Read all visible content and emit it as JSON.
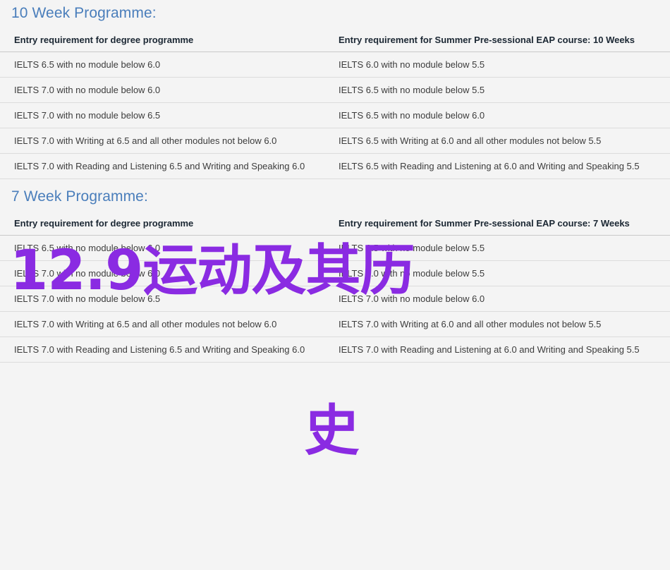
{
  "colors": {
    "background": "#f4f4f4",
    "heading": "#4a7ebb",
    "header_text": "#1b2733",
    "cell_text": "#3c3c3c",
    "row_border": "#dcdcdc",
    "header_border": "#c9c9c9",
    "watermark": "#8A2BE2"
  },
  "watermark": {
    "line1": "12.9运动及其历",
    "line2": "史",
    "full_text": "12.9运动及其历史"
  },
  "sections": [
    {
      "heading": "10 Week Programme:",
      "left_table": {
        "header": "Entry requirement for degree programme",
        "rows": [
          "IELTS 6.5 with no module below 6.0",
          "IELTS 7.0 with no module below 6.0",
          "IELTS 7.0 with no module below 6.5",
          "IELTS 7.0 with Writing at 6.5 and all other modules not below 6.0",
          "IELTS 7.0 with Reading and Listening 6.5 and Writing and Speaking 6.0"
        ]
      },
      "right_table": {
        "header": "Entry requirement for Summer Pre-sessional EAP course: 10 Weeks",
        "rows": [
          "IELTS 6.0 with no module below 5.5",
          "IELTS 6.5 with no module below 5.5",
          "IELTS 6.5 with no module below 6.0",
          "IELTS 6.5 with Writing at 6.0 and all other modules not below 5.5",
          "IELTS 6.5 with Reading and Listening at 6.0 and Writing and Speaking 5.5"
        ]
      }
    },
    {
      "heading": "7 Week Programme:",
      "left_table": {
        "header": "Entry requirement for degree programme",
        "rows": [
          "IELTS 6.5 with no module below 6.0",
          "IELTS 7.0 with no module below 6.0",
          "IELTS 7.0 with no module below 6.5",
          "IELTS 7.0 with Writing at 6.5 and all other modules not below 6.0",
          "IELTS 7.0 with Reading and Listening 6.5 and Writing and Speaking 6.0"
        ]
      },
      "right_table": {
        "header": "Entry requirement for Summer Pre-sessional EAP course: 7 Weeks",
        "rows": [
          "IELTS 6.5 with no module below 5.5",
          "IELTS 7.0 with no module below 5.5",
          "IELTS 7.0 with no module below 6.0",
          "IELTS 7.0 with Writing at 6.0 and all other modules not below 5.5",
          "IELTS 7.0 with Reading and Listening at 6.0 and Writing and Speaking 5.5"
        ]
      }
    }
  ]
}
